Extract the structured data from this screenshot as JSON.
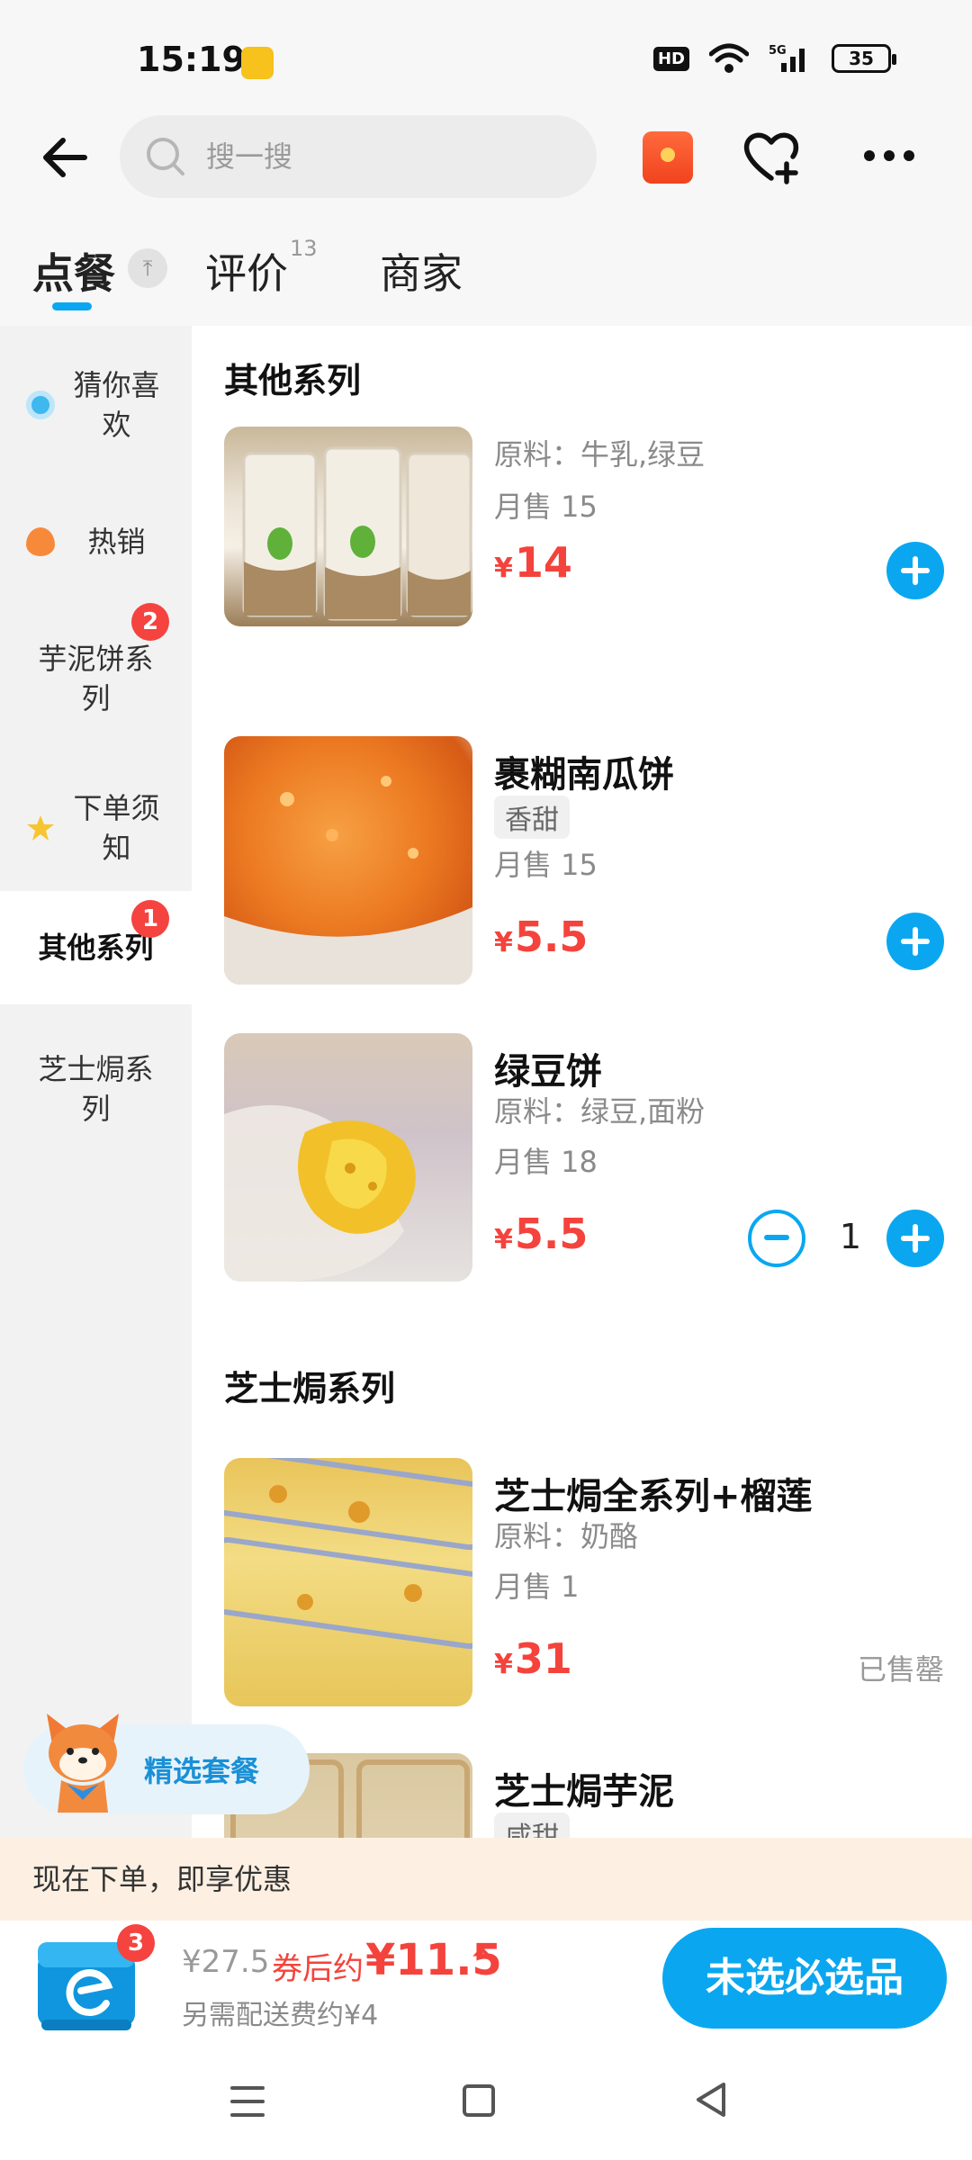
{
  "status_bar": {
    "time": "15:19",
    "hd": "HD",
    "network": "5G",
    "battery": "35"
  },
  "header": {
    "search_placeholder": "搜一搜"
  },
  "tabs": {
    "order": "点餐",
    "review": "评价",
    "review_count": "13",
    "store": "商家"
  },
  "sidebar": {
    "items": [
      {
        "label": "猜你喜欢",
        "icon": "eye-icon"
      },
      {
        "label": "热销",
        "icon": "flame-icon"
      },
      {
        "label": "芋泥饼系列",
        "badge": "2"
      },
      {
        "label": "下单须知",
        "icon": "star-icon"
      },
      {
        "label": "其他系列",
        "badge": "1"
      },
      {
        "label": "芝士焗系列"
      }
    ]
  },
  "sections": [
    {
      "title": "其他系列"
    },
    {
      "title": "芝士焗系列"
    }
  ],
  "products": [
    {
      "name": "",
      "ingredients": "原料：牛乳,绿豆",
      "monthly_sales": "月售 15",
      "currency": "¥",
      "price": "14"
    },
    {
      "name": "裹糊南瓜饼",
      "tag": "香甜",
      "monthly_sales": "月售 15",
      "currency": "¥",
      "price": "5.5"
    },
    {
      "name": "绿豆饼",
      "ingredients": "原料：绿豆,面粉",
      "monthly_sales": "月售 18",
      "currency": "¥",
      "price": "5.5",
      "quantity": "1"
    },
    {
      "name": "芝士焗全系列+榴莲",
      "ingredients": "原料：奶酪",
      "monthly_sales": "月售 1",
      "currency": "¥",
      "price": "31",
      "status": "已售罄"
    },
    {
      "name": "芝士焗芋泥",
      "tag": "咸甜"
    }
  ],
  "promo_float": {
    "label": "精选套餐"
  },
  "promo_bar": {
    "text": "现在下单，即享优惠"
  },
  "cart": {
    "badge": "3",
    "original_price": "¥27.5",
    "after_coupon_label": "券后约",
    "final_price": "¥11.5",
    "caret": "^",
    "delivery_note": "另需配送费约¥4",
    "checkout_label": "未选必选品"
  },
  "colors": {
    "accent": "#0aa7f0",
    "price": "#f4433c",
    "promo_bg": "#fdf0e2"
  }
}
